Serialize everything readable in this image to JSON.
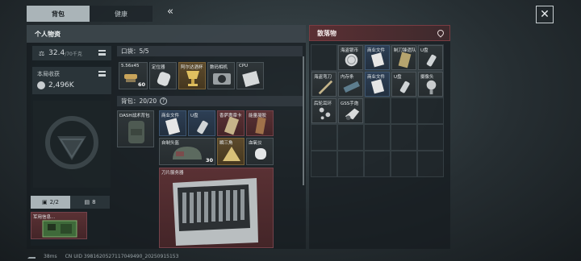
{
  "tabs": [
    {
      "label": "背包",
      "active": true
    },
    {
      "label": "健康",
      "active": false
    }
  ],
  "collapse_glyph": "«",
  "personal": {
    "title": "个人物资",
    "weight": {
      "value": "32.4",
      "unit": "/70千克"
    },
    "income": {
      "label": "本局收获",
      "value": "2,496K"
    },
    "backpack_label": "DASH战术背包",
    "counter": "2/2",
    "counter2": "8",
    "slot_item": "军用信息…",
    "pockets": {
      "title": "口袋：5/5",
      "items": [
        {
          "label": "5.56x45",
          "count": "60"
        },
        {
          "label": "定位器",
          "count": ""
        },
        {
          "label": "阿尔达酒杯",
          "count": ""
        },
        {
          "label": "数码相机",
          "count": ""
        },
        {
          "label": "CPU",
          "count": ""
        }
      ]
    },
    "backpack": {
      "title": "背包：20/20",
      "items": [
        {
          "label": "商业文件"
        },
        {
          "label": "U盘"
        },
        {
          "label": "香萨惠章卡"
        },
        {
          "label": "能量凝胶"
        },
        {
          "label": "自制头盔",
          "count": "30"
        },
        {
          "label": "瞬三角"
        },
        {
          "label": "血氧仪"
        },
        {
          "label": "刀片服务器"
        }
      ]
    }
  },
  "drops": {
    "title": "散落物",
    "items": [
      {
        "label": "海盗银币"
      },
      {
        "label": "商业文件"
      },
      {
        "label": "制刀锋遗队"
      },
      {
        "label": "U盘"
      },
      {
        "label": "海盗弯刀"
      },
      {
        "label": "内存条"
      },
      {
        "label": "商业文件"
      },
      {
        "label": "U盘"
      },
      {
        "label": "摄像头"
      },
      {
        "label": "后轮耳环"
      },
      {
        "label": "GSS手炮"
      }
    ]
  },
  "status": {
    "ping": "38ms",
    "uid": "CN UID 3981620527117049490_20250915153"
  },
  "colors": {
    "accent_red": "#5a2f33",
    "tab_active": "#aab4b8"
  }
}
